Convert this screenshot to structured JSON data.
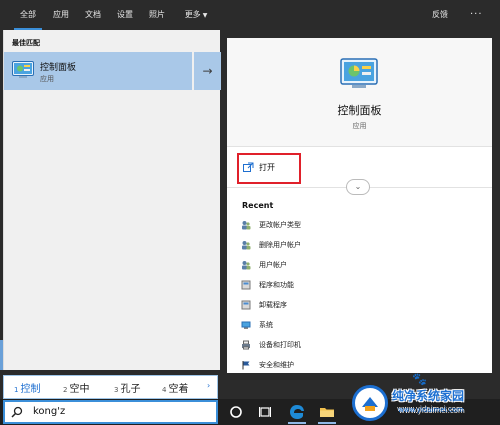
{
  "filter_tabs": [
    {
      "label": "全部",
      "active": true
    },
    {
      "label": "应用",
      "active": false
    },
    {
      "label": "文档",
      "active": false
    },
    {
      "label": "设置",
      "active": false
    },
    {
      "label": "照片",
      "active": false
    },
    {
      "label": "更多",
      "active": false,
      "dropdown": true
    }
  ],
  "header": {
    "feedback_label": "反馈",
    "more_label": "···"
  },
  "left": {
    "section_label": "最佳匹配",
    "best_match": {
      "title": "控制面板",
      "subtitle": "应用",
      "icon": "control-panel-icon",
      "arrow": "→"
    }
  },
  "right": {
    "app_title": "控制面板",
    "app_subtitle": "应用",
    "open_label": "打开",
    "expand_glyph": "⌄",
    "recent_title": "Recent",
    "recent": [
      {
        "label": "更改帐户类型",
        "icon": "users-icon"
      },
      {
        "label": "删除用户帐户",
        "icon": "users-icon"
      },
      {
        "label": "用户帐户",
        "icon": "users-icon"
      },
      {
        "label": "程序和功能",
        "icon": "programs-icon"
      },
      {
        "label": "卸载程序",
        "icon": "programs-icon"
      },
      {
        "label": "系统",
        "icon": "system-icon"
      },
      {
        "label": "设备和打印机",
        "icon": "printer-icon"
      },
      {
        "label": "安全和维护",
        "icon": "flag-icon"
      }
    ]
  },
  "ime": {
    "candidates": [
      {
        "num": "1",
        "text": "控制",
        "selected": true
      },
      {
        "num": "2",
        "text": "空中",
        "selected": false
      },
      {
        "num": "3",
        "text": "孔子",
        "selected": false
      },
      {
        "num": "4",
        "text": "空着",
        "selected": false
      }
    ],
    "next_arrow": "›"
  },
  "search": {
    "value": "kong'z"
  },
  "watermark": {
    "title": "纯净系统家园",
    "url": "www.yidaimei.com"
  },
  "colors": {
    "accent": "#3b8fd9",
    "highlight": "#a9c8e8",
    "red_box": "#e0202a",
    "watermark_blue": "#1c6fd1"
  }
}
